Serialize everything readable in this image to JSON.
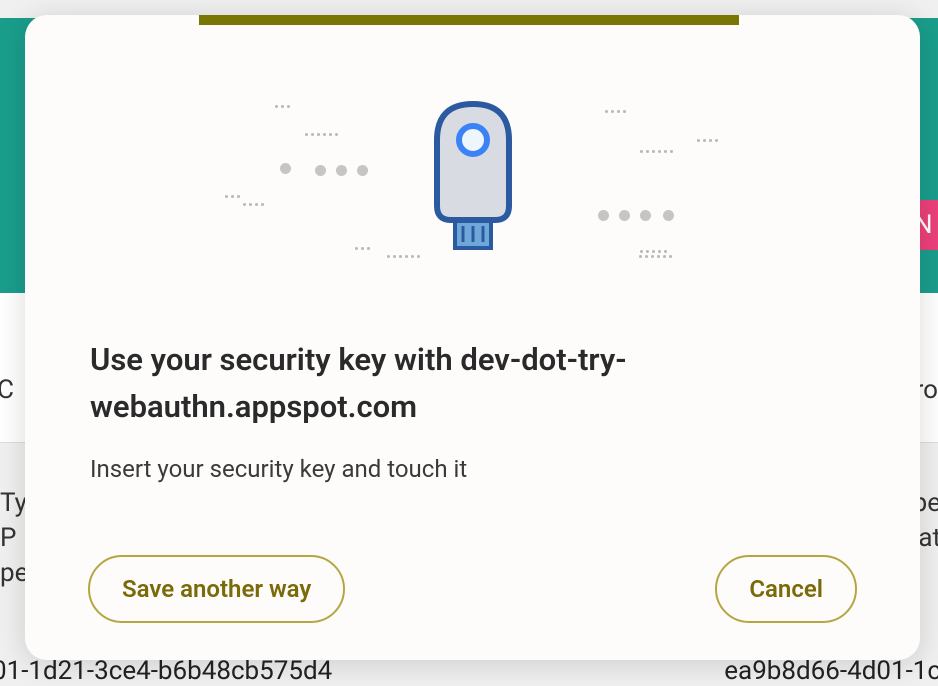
{
  "dialog": {
    "title": "Use your security key with dev-dot-try-webauthn.appspot.com",
    "subtitle": "Insert your security key and touch it",
    "save_button_label": "Save another way",
    "cancel_button_label": "Cancel",
    "accent_color": "#7a7604",
    "icon_name": "usb-security-key"
  },
  "background": {
    "header_color": "#1a9e8c",
    "left_partial_1": "C",
    "left_partial_2": "Ty\nP\npe",
    "right_partial_1": "ro",
    "right_partial_2": "pe\nat\n",
    "right_badge": "N",
    "bottom_left": "01-1d21-3ce4-b6b48cb575d4",
    "bottom_right": "ea9b8d66-4d01-1c"
  }
}
